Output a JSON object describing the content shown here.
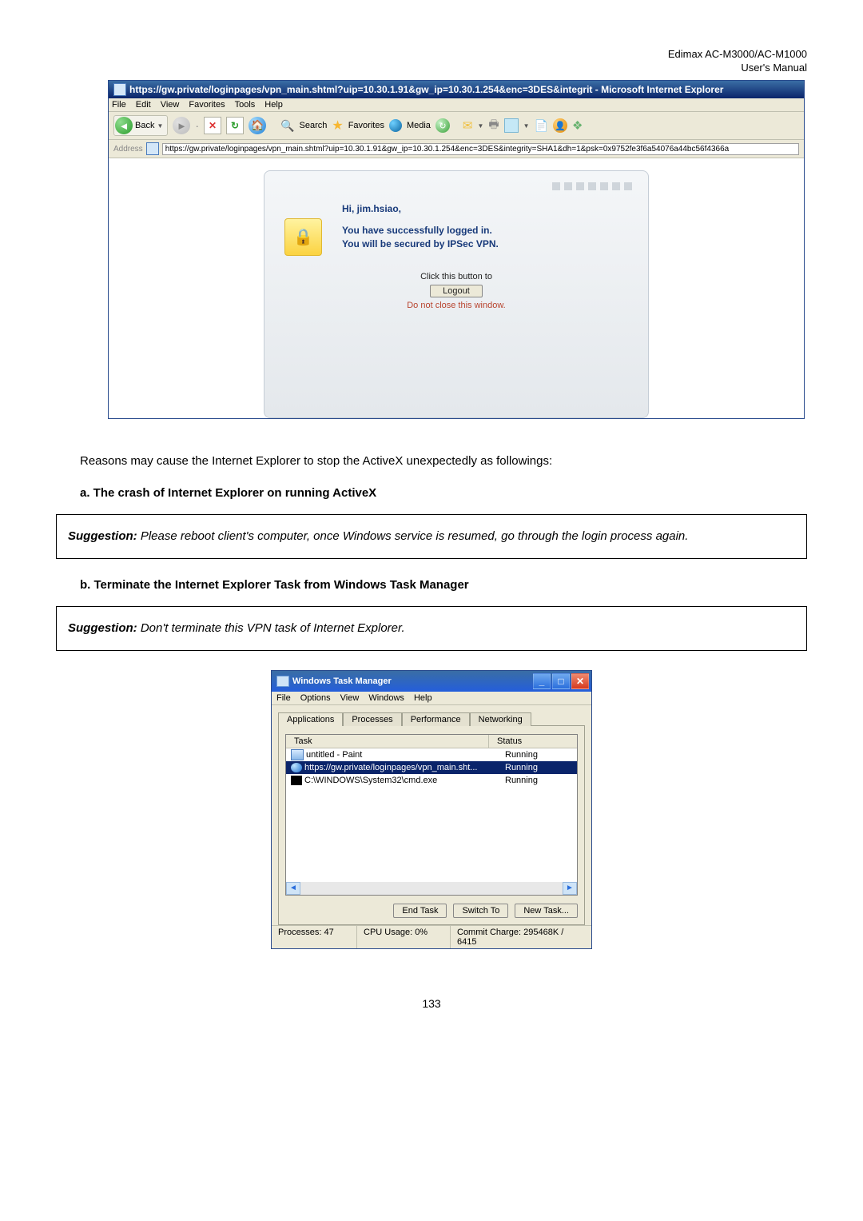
{
  "header": {
    "product": "Edimax  AC-M3000/AC-M1000",
    "subtitle": "User's  Manual"
  },
  "ie": {
    "title_text": "https://gw.private/loginpages/vpn_main.shtml?uip=10.30.1.91&gw_ip=10.30.1.254&enc=3DES&integrit - Microsoft Internet Explorer",
    "menu": [
      "File",
      "Edit",
      "View",
      "Favorites",
      "Tools",
      "Help"
    ],
    "toolbar": {
      "back_label": "Back",
      "search_label": "Search",
      "favorites_label": "Favorites",
      "media_label": "Media"
    },
    "address_label": "Address",
    "url": "https://gw.private/loginpages/vpn_main.shtml?uip=10.30.1.91&gw_ip=10.30.1.254&enc=3DES&integrity=SHA1&dh=1&psk=0x9752fe3f6a54076a44bc56f4366a",
    "vpn": {
      "greeting": "Hi, jim.hsiao,",
      "line1": "You have successfully logged in.",
      "line2": "You will be secured by IPSec VPN.",
      "click_label": "Click this button to",
      "logout_btn": "Logout",
      "warn": "Do not close this window."
    }
  },
  "doc": {
    "reasons_line": "Reasons may cause the Internet Explorer to stop the ActiveX unexpectedly as followings:",
    "heading_a": "a.    The crash of Internet Explorer on running ActiveX",
    "suggestion_a_lead": "Suggestion:",
    "suggestion_a_body": " Please reboot client's computer, once Windows service is resumed, go through the login process again.",
    "heading_b": "b.    Terminate the Internet Explorer Task from Windows Task Manager",
    "suggestion_b_lead": "Suggestion:",
    "suggestion_b_body": " Don't terminate this VPN task of Internet Explorer."
  },
  "tm": {
    "title": "Windows Task Manager",
    "menu": [
      "File",
      "Options",
      "View",
      "Windows",
      "Help"
    ],
    "tabs": [
      "Applications",
      "Processes",
      "Performance",
      "Networking"
    ],
    "head_task": "Task",
    "head_status": "Status",
    "rows": [
      {
        "name": "untitled - Paint",
        "status": "Running"
      },
      {
        "name": "https://gw.private/loginpages/vpn_main.sht...",
        "status": "Running"
      },
      {
        "name": "C:\\WINDOWS\\System32\\cmd.exe",
        "status": "Running"
      }
    ],
    "btn_end": "End Task",
    "btn_switch": "Switch To",
    "btn_new": "New Task...",
    "status_procs": "Processes: 47",
    "status_cpu": "CPU Usage: 0%",
    "status_commit": "Commit Charge: 295468K / 6415"
  },
  "page_number": "133"
}
